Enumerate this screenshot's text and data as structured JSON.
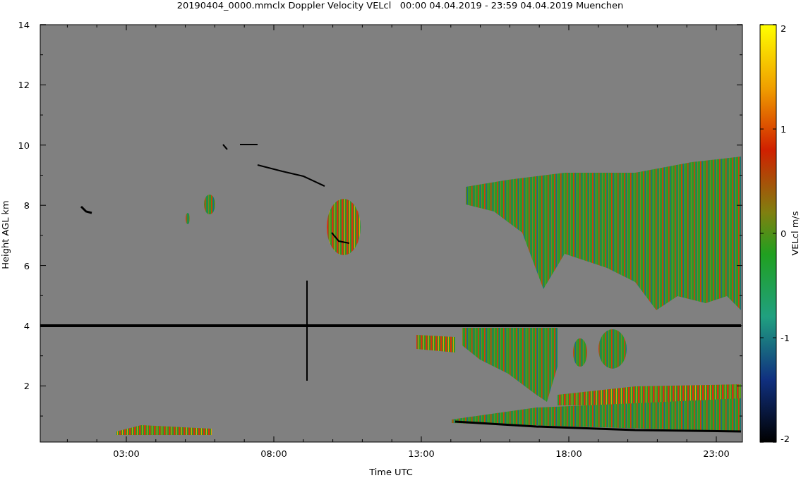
{
  "title": "20190404_0000.mmclx Doppler Velocity VELcl   00:00 04.04.2019 - 23:59 04.04.2019 Muenchen",
  "plot": {
    "y_axis": {
      "label": "Height AGL km",
      "ticks": [
        "14",
        "12",
        "10",
        "8",
        "6",
        "4",
        "2"
      ]
    },
    "x_axis": {
      "label": "Time UTC",
      "ticks": [
        "03:00",
        "08:00",
        "13:00",
        "18:00",
        "23:00"
      ]
    }
  },
  "colorbar": {
    "label": "VELcl m/s",
    "ticks": [
      "2",
      "1",
      "0",
      "-1",
      "-2"
    ]
  }
}
